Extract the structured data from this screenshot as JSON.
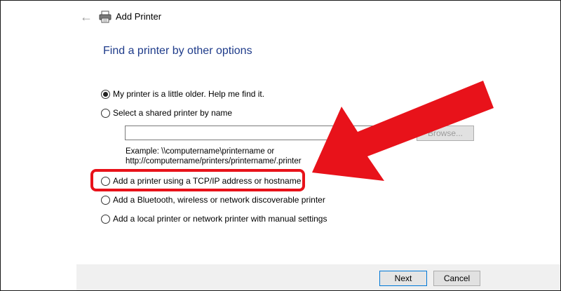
{
  "window": {
    "title": "Add Printer",
    "heading": "Find a printer by other options"
  },
  "options": [
    {
      "label": "My printer is a little older. Help me find it.",
      "checked": true
    },
    {
      "label": "Select a shared printer by name",
      "checked": false
    },
    {
      "label": "Add a printer using a TCP/IP address or hostname",
      "checked": false
    },
    {
      "label": "Add a Bluetooth, wireless or network discoverable printer",
      "checked": false
    },
    {
      "label": "Add a local printer or network printer with manual settings",
      "checked": false
    }
  ],
  "shared_printer": {
    "value": "",
    "browse_label": "Browse...",
    "example_line1": "Example: \\\\computername\\printername or",
    "example_line2": "http://computername/printers/printername/.printer"
  },
  "footer": {
    "next_label": "Next",
    "cancel_label": "Cancel"
  },
  "annotation": {
    "highlight_color": "#e8121a",
    "arrow_color": "#e8121a"
  },
  "icons": {
    "back": "back-arrow-icon",
    "printer": "printer-icon"
  }
}
